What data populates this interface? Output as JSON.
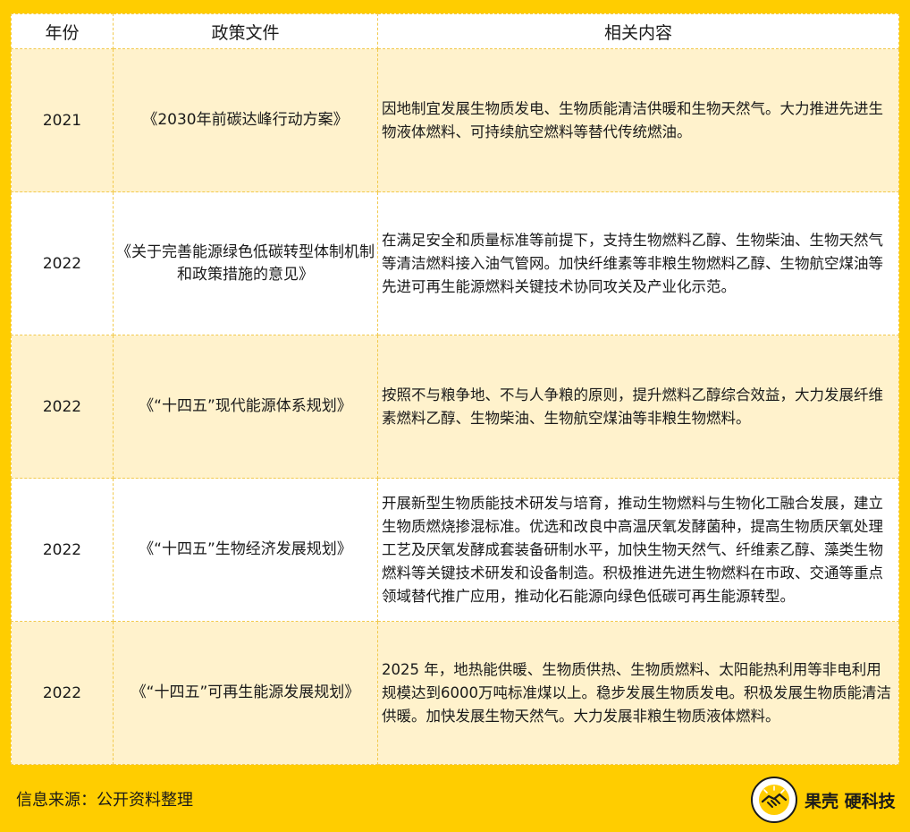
{
  "table": {
    "headers": [
      "年份",
      "政策文件",
      "相关内容"
    ],
    "rows": [
      {
        "year": "2021",
        "document": "《2030年前碳达峰行动方案》",
        "content": "因地制宜发展生物质发电、生物质能清洁供暖和生物天然气。大力推进先进生物液体燃料、可持续航空燃料等替代传统燃油。"
      },
      {
        "year": "2022",
        "document": "《关于完善能源绿色低碳转型体制机制和政策措施的意见》",
        "content": "在满足安全和质量标准等前提下，支持生物燃料乙醇、生物柴油、生物天然气等清洁燃料接入油气管网。加快纤维素等非粮生物燃料乙醇、生物航空煤油等先进可再生能源燃料关键技术协同攻关及产业化示范。"
      },
      {
        "year": "2022",
        "document": "《“十四五”现代能源体系规划》",
        "content": "按照不与粮争地、不与人争粮的原则，提升燃料乙醇综合效益，大力发展纤维素燃料乙醇、生物柴油、生物航空煤油等非粮生物燃料。"
      },
      {
        "year": "2022",
        "document": "《“十四五”生物经济发展规划》",
        "content": "开展新型生物质能技术研发与培育，推动生物燃料与生物化工融合发展，建立生物质燃烧掺混标准。优选和改良中高温厌氧发酵菌种，提高生物质厌氧处理工艺及厌氧发酵成套装备研制水平，加快生物天然气、纤维素乙醇、藻类生物燃料等关键技术研发和设备制造。积极推进先进生物燃料在市政、交通等重点领域替代推广应用，推动化石能源向绿色低碳可再生能源转型。"
      },
      {
        "year": "2022",
        "document": "《“十四五”可再生能源发展规划》",
        "content": "2025 年，地热能供暖、生物质供热、生物质燃料、太阳能热利用等非电利用规模达到6000万吨标准煤以上。稳步发展生物质发电。积极发展生物质能清洁供暖。加快发展生物天然气。大力发展非粮生物质液体燃料。"
      }
    ]
  },
  "footer": {
    "source": "信息来源：公开资料整理",
    "brand": "果壳 硬科技",
    "brand_icon": "handshake-icon"
  },
  "colors": {
    "background": "#ffcd00",
    "row_alt": "#fff2cc",
    "border": "#f2c94c"
  }
}
